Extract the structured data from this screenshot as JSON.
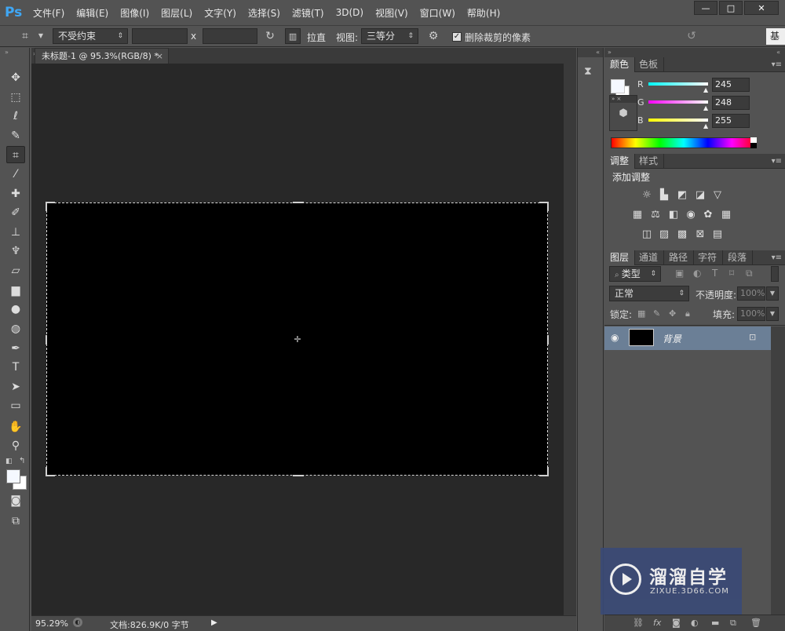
{
  "app": {
    "logo": "Ps",
    "menus": [
      "文件(F)",
      "编辑(E)",
      "图像(I)",
      "图层(L)",
      "文字(Y)",
      "选择(S)",
      "滤镜(T)",
      "3D(D)",
      "视图(V)",
      "窗口(W)",
      "帮助(H)"
    ],
    "window_controls": {
      "minimize": "—",
      "maximize": "□",
      "close": "✕"
    }
  },
  "options": {
    "ratio_preset": "不受约束",
    "x_sep": "x",
    "straighten_label": "拉直",
    "view_label": "视图:",
    "view_value": "三等分",
    "delete_cropped_label": "删除裁剪的像素",
    "delete_cropped_checked": true,
    "essentials_label": "基"
  },
  "document": {
    "tab_title": "未标题-1 @ 95.3%(RGB/8) *",
    "tab_close": "×",
    "canvas_color": "#000000"
  },
  "status": {
    "zoom": "95.29%",
    "doc_info": "文档:826.9K/0 字节"
  },
  "panels": {
    "color": {
      "tabs": [
        "颜色",
        "色板"
      ],
      "channels": [
        {
          "name": "R",
          "value": "245",
          "color": "#3ec7ee"
        },
        {
          "name": "G",
          "value": "248",
          "color": "#e03ce0"
        },
        {
          "name": "B",
          "value": "255",
          "color": "#e9e944"
        }
      ]
    },
    "adjustments": {
      "tabs": [
        "调整",
        "样式"
      ],
      "title": "添加调整"
    },
    "layers": {
      "tabs": [
        "图层",
        "通道",
        "路径",
        "字符",
        "段落"
      ],
      "filter_label": "类型",
      "blend_mode": "正常",
      "opacity_label": "不透明度:",
      "opacity_value": "100%",
      "lock_label": "锁定:",
      "fill_label": "填充:",
      "fill_value": "100%",
      "items": [
        {
          "name": "背景",
          "visible": true,
          "locked": true
        }
      ]
    }
  },
  "watermark": {
    "brand": "溜溜自学",
    "url": "ZIXUE.3D66.COM"
  }
}
